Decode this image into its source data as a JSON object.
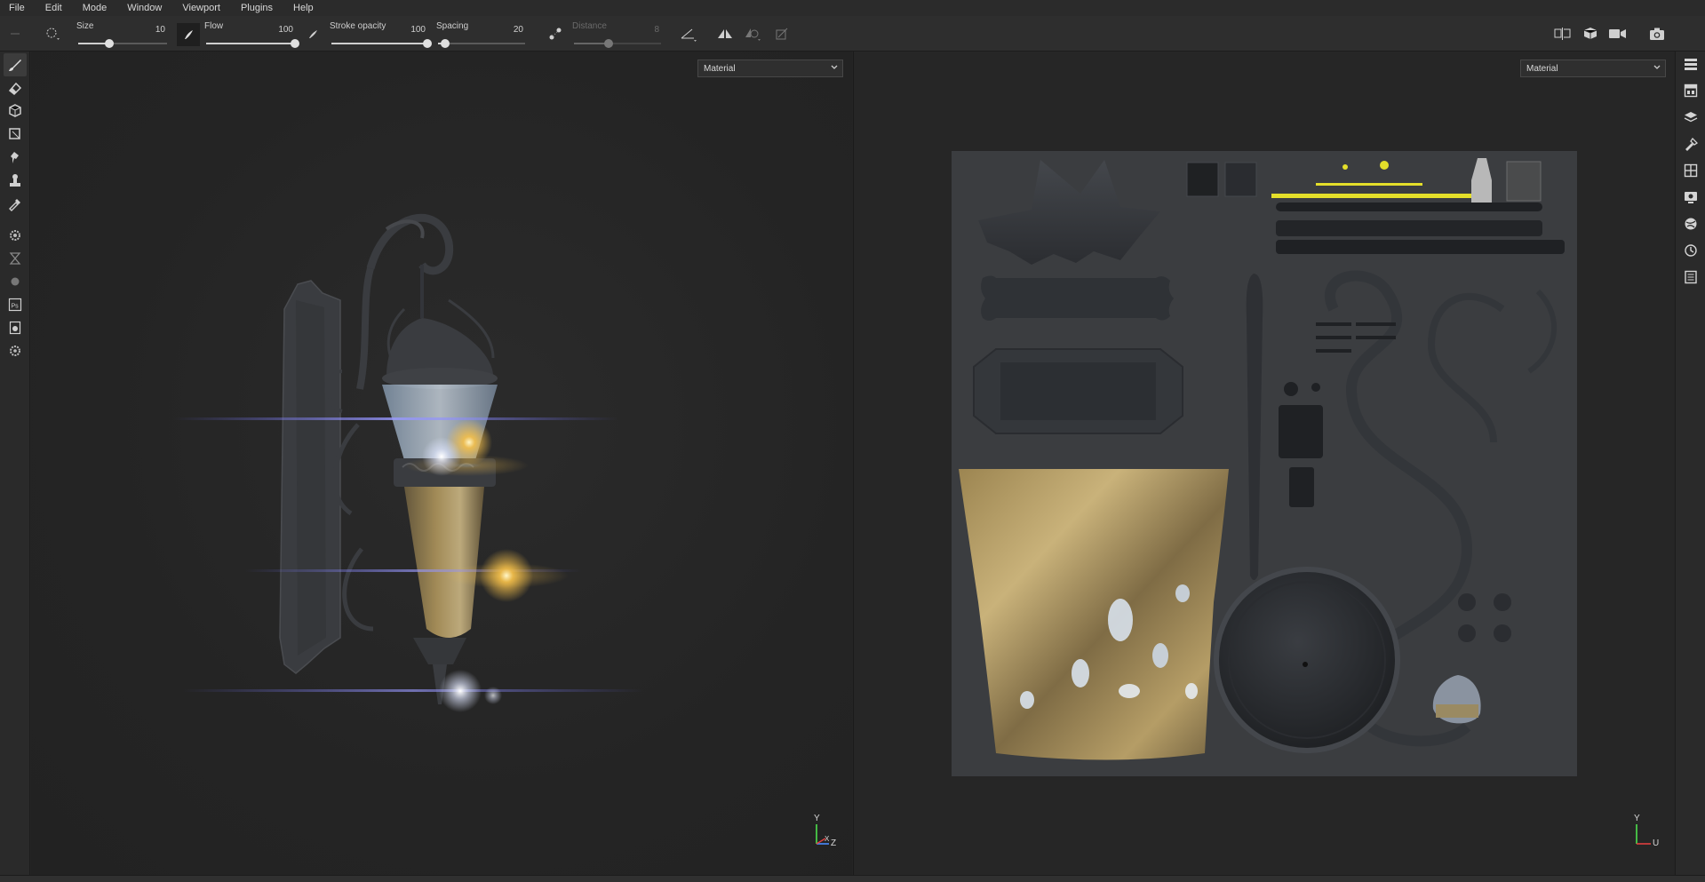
{
  "menu": [
    "File",
    "Edit",
    "Mode",
    "Window",
    "Viewport",
    "Plugins",
    "Help"
  ],
  "toolbar": {
    "sliders": [
      {
        "label": "Size",
        "value": "10",
        "fraction": 0.35,
        "enabled": true
      },
      {
        "label": "Flow",
        "value": "100",
        "fraction": 1.0,
        "enabled": true
      },
      {
        "label": "Stroke opacity",
        "value": "100",
        "fraction": 1.0,
        "enabled": true
      },
      {
        "label": "Spacing",
        "value": "20",
        "fraction": 0.08,
        "enabled": true
      },
      {
        "label": "Distance",
        "value": "8",
        "fraction": 0.4,
        "enabled": false
      }
    ]
  },
  "viewport3d": {
    "mode": "Material",
    "axis_y": "Y",
    "axis_z": "Z",
    "axis_x": "X"
  },
  "viewport2d": {
    "mode": "Material",
    "axis_y": "Y",
    "axis_u": "U"
  },
  "colors": {
    "accent_glow": "#f5c04a",
    "lens_flare": "#6c6cff",
    "metal": "#3a3c40",
    "glass": "#b79c5f"
  },
  "icons": {
    "left": [
      "brush-icon",
      "eraser-icon",
      "projection-icon",
      "geometry-icon",
      "smudge-icon",
      "clone-icon",
      "color-picker-icon",
      "settings-icon",
      "bake-icon",
      "material-icon",
      "photoshop-icon",
      "export-icon",
      "gear-icon"
    ],
    "right": [
      "layers-panel-icon",
      "texture-set-icon",
      "layer-stack-icon",
      "brush-presets-icon",
      "uv-tiles-icon",
      "display-icon",
      "environment-icon",
      "history-icon",
      "log-icon"
    ]
  }
}
